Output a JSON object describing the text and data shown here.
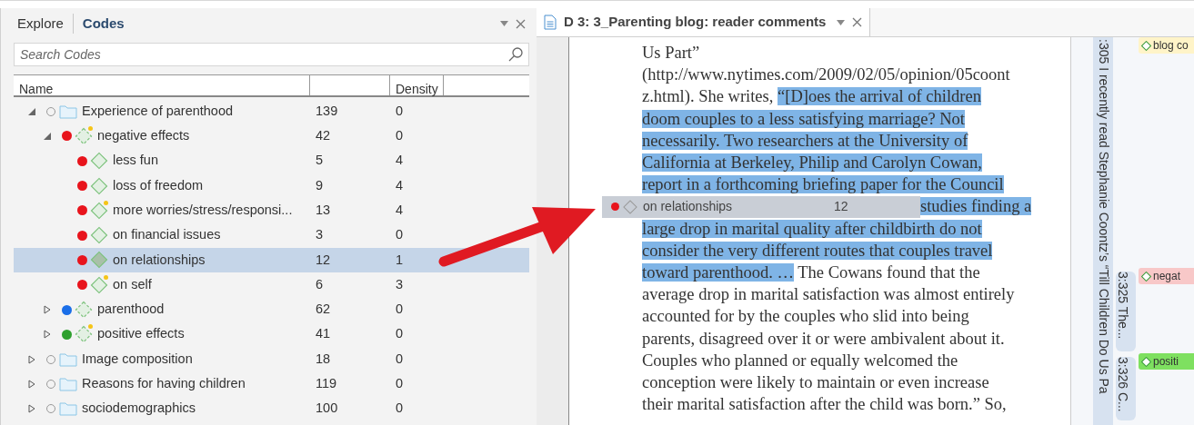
{
  "codes_panel": {
    "tabs": [
      {
        "label": "Explore",
        "selected": false
      },
      {
        "label": "Codes",
        "selected": true
      }
    ],
    "search": {
      "placeholder": "Search Codes"
    },
    "columns": [
      "Name",
      "",
      "Density"
    ],
    "tree": [
      {
        "kind": "folder",
        "name": "Experience of parenthood",
        "count": "139",
        "density": "0",
        "expanded": true,
        "selected": false,
        "children": [
          {
            "kind": "code",
            "name": "negative effects",
            "count": "42",
            "density": "0",
            "color": "#e8141c",
            "memo": true,
            "expanded": true,
            "selected": false,
            "children": [
              {
                "kind": "code",
                "name": "less fun",
                "count": "5",
                "density": "4",
                "color": "#e8141c",
                "memo": false,
                "selected": false
              },
              {
                "kind": "code",
                "name": "loss of freedom",
                "count": "9",
                "density": "4",
                "color": "#e8141c",
                "memo": false,
                "selected": false
              },
              {
                "kind": "code",
                "name": "more worries/stress/responsi...",
                "count": "13",
                "density": "4",
                "color": "#e8141c",
                "memo": true,
                "selected": false
              },
              {
                "kind": "code",
                "name": "on financial issues",
                "count": "3",
                "density": "0",
                "color": "#e8141c",
                "memo": false,
                "selected": false
              },
              {
                "kind": "code",
                "name": "on relationships",
                "count": "12",
                "density": "1",
                "color": "#e8141c",
                "memo": false,
                "selected": true
              },
              {
                "kind": "code",
                "name": "on self",
                "count": "6",
                "density": "3",
                "color": "#e8141c",
                "memo": true,
                "selected": false
              }
            ]
          },
          {
            "kind": "code",
            "name": "parenthood",
            "count": "62",
            "density": "0",
            "color": "#1a6ee8",
            "memo": false,
            "expanded": false,
            "selected": false
          },
          {
            "kind": "code",
            "name": "positive effects",
            "count": "41",
            "density": "0",
            "color": "#2ea02e",
            "memo": true,
            "expanded": false,
            "selected": false
          }
        ]
      },
      {
        "kind": "folder",
        "name": "Image composition",
        "count": "18",
        "density": "0",
        "expanded": false,
        "selected": false
      },
      {
        "kind": "folder",
        "name": "Reasons for having children",
        "count": "119",
        "density": "0",
        "expanded": false,
        "selected": false
      },
      {
        "kind": "folder",
        "name": "sociodemographics",
        "count": "100",
        "density": "0",
        "expanded": false,
        "selected": false
      }
    ]
  },
  "document": {
    "tab": {
      "title": "D 3: 3_Parenting blog: reader comments"
    },
    "lines": [
      [
        {
          "text": "Us Part”",
          "highlighted": false
        }
      ],
      [
        {
          "text": "(http://www.nytimes.com/2009/02/05/opinion/05coont",
          "highlighted": false
        }
      ],
      [
        {
          "text": "z.html). She writes, ",
          "highlighted": false
        },
        {
          "text": "“[D]oes the arrival of children",
          "highlighted": true
        }
      ],
      [
        {
          "text": "doom couples to a less satisfying marriage? Not",
          "highlighted": true
        }
      ],
      [
        {
          "text": "necessarily. Two researchers at the University of",
          "highlighted": true
        }
      ],
      [
        {
          "text": "California at Berkeley, Philip and Carolyn Cowan,",
          "highlighted": true
        }
      ],
      [
        {
          "text": "report in a forthcoming briefing paper for the Council",
          "highlighted": true
        }
      ],
      {
        "drag_ghost": {
          "name": "on relationships",
          "count": "12",
          "color": "#e8141c"
        },
        "segments": [
          {
            "text": "studies finding a",
            "highlighted": true
          }
        ]
      },
      [
        {
          "text": "large drop in marital quality after childbirth do not",
          "highlighted": true
        }
      ],
      [
        {
          "text": "consider the very different routes that couples travel",
          "highlighted": true
        }
      ],
      [
        {
          "text": "toward parenthood. …",
          "highlighted": true
        },
        {
          "text": " The Cowans found that the",
          "highlighted": false
        }
      ],
      [
        {
          "text": "average drop in marital satisfaction was almost entirely",
          "highlighted": false
        }
      ],
      [
        {
          "text": "accounted for by the couples who slid into being",
          "highlighted": false
        }
      ],
      [
        {
          "text": "parents, disagreed over it or were ambivalent about it.",
          "highlighted": false
        }
      ],
      [
        {
          "text": "Couples who planned or equally welcomed the",
          "highlighted": false
        }
      ],
      [
        {
          "text": "conception were likely to maintain or even increase",
          "highlighted": false
        }
      ],
      [
        {
          "text": "their marital satisfaction after the child was born.” So,",
          "highlighted": false
        }
      ]
    ],
    "quotation_bar": ":305 I recently read Stephanie Coontz’s “Till Children Do Us Pa",
    "quotation_bubbles": [
      "3:325 The...",
      "3:326 C..."
    ],
    "code_tags": [
      {
        "label": "blog co",
        "color": "#fff4c8"
      },
      {
        "label": "negat",
        "color": "#f8c8c8"
      },
      {
        "label": "positi",
        "color": "#7ee060"
      }
    ]
  }
}
